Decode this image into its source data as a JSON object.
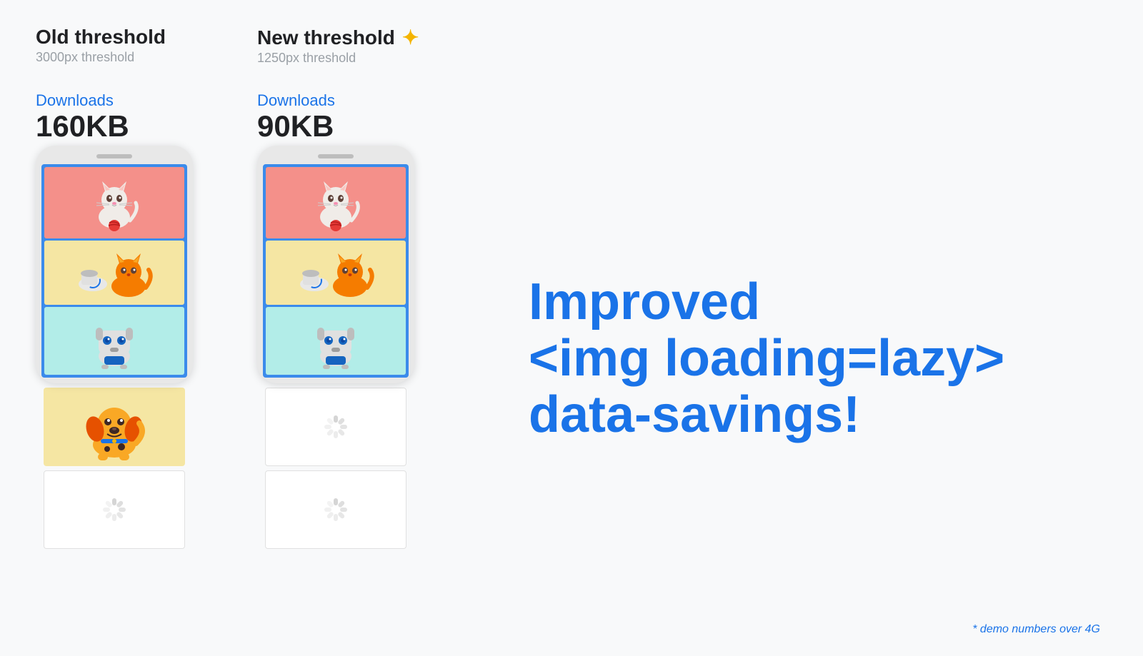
{
  "page": {
    "background": "#f8f9fa"
  },
  "old_threshold": {
    "title": "Old threshold",
    "subtitle": "3000px threshold",
    "downloads_label": "Downloads",
    "downloads_value": "160KB"
  },
  "new_threshold": {
    "title": "New threshold",
    "subtitle": "1250px threshold",
    "downloads_label": "Downloads",
    "downloads_value": "90KB"
  },
  "headline": {
    "line1": "Improved",
    "line2": "<img loading=lazy>",
    "line3": "data-savings!"
  },
  "footnote": "* demo numbers over 4G",
  "sparkle_icon": "✦"
}
